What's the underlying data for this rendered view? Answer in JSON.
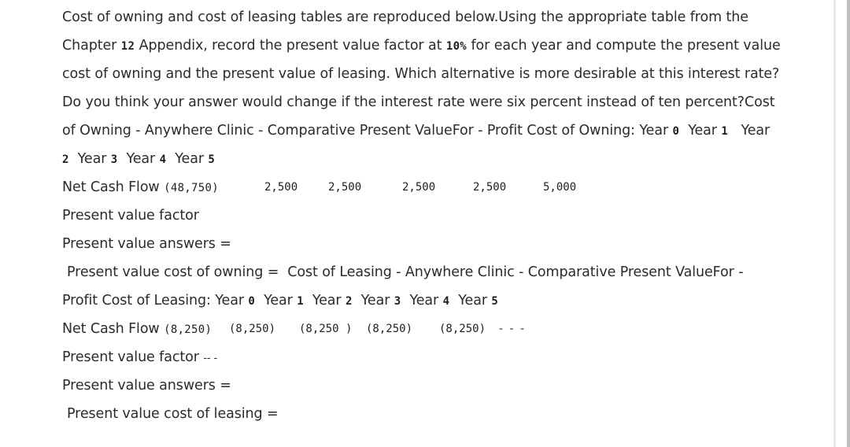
{
  "question": {
    "line1": "Cost of owning and cost of leasing tables are reproduced below.Using the appropriate table from the",
    "line2_pre": "Chapter ",
    "line2_chapter": "12",
    "line2_mid": " Appendix, record the present value factor at ",
    "line2_rate": "10%",
    "line2_post": " for each year and compute the present value",
    "line3": "cost of owning and the present value of leasing. Which alternative is more desirable at this interest rate?",
    "line4": "Do you think your answer would change if the interest rate were six percent instead of ten percent?Cost"
  },
  "owning": {
    "heading_pre": "of Owning -  Anywhere Clinic  -  Comparative Present ValueFor - Profit Cost of Owning: Year ",
    "years": [
      "0",
      "1",
      "2",
      "3",
      "4",
      "5"
    ],
    "year_label": "Year",
    "net_cash_flow_label": "Net Cash Flow",
    "net_cash_flows": [
      "(48,750)",
      "2,500",
      "2,500",
      "2,500",
      "2,500",
      "5,000"
    ],
    "pv_factor_label": "Present value factor",
    "pv_answers_label": "Present value answers  =",
    "pv_cost_label": "Present value cost of owning  ="
  },
  "leasing": {
    "heading_line1": "Cost of Leasing -  Anywhere Clinic  -  Comparative Present ValueFor -",
    "heading_line2_pre": "Profit Cost of Leasing: Year ",
    "years": [
      "0",
      "1",
      "2",
      "3",
      "4",
      "5"
    ],
    "year_label": "Year",
    "net_cash_flow_label": "Net Cash Flow",
    "net_cash_flows": [
      "(8,250)",
      "(8,250)",
      "(8,250 )",
      "(8,250)",
      "(8,250)",
      "- - -"
    ],
    "pv_factor_label": "Present value factor",
    "pv_factor_dashes": "-- -",
    "pv_answers_label": "Present value answers  =",
    "pv_cost_label": "Present value cost of leasing  ="
  }
}
